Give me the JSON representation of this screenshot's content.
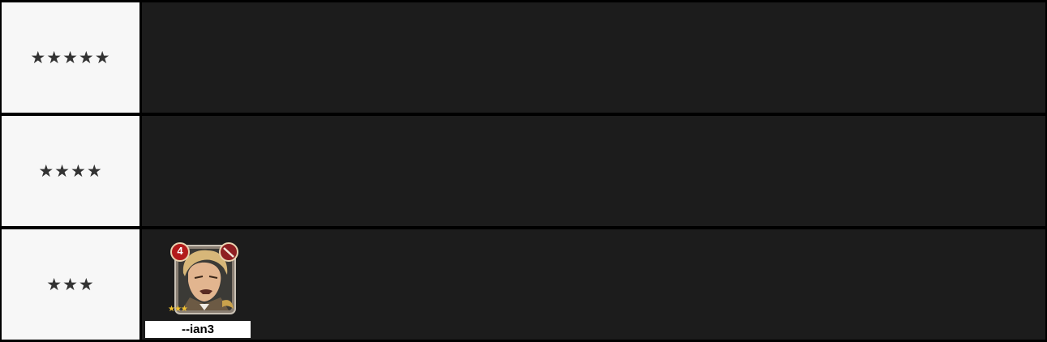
{
  "tiers": [
    {
      "label": "★★★★★",
      "characters": []
    },
    {
      "label": "★★★★",
      "characters": []
    },
    {
      "label": "★★★",
      "characters": [
        {
          "name": "--ian3",
          "level": "4",
          "rarity_stars": "★★★"
        }
      ]
    }
  ],
  "colors": {
    "label_bg": "#f7f7f7",
    "content_bg": "#1c1c1c",
    "border": "#000000",
    "star": "#333333"
  }
}
